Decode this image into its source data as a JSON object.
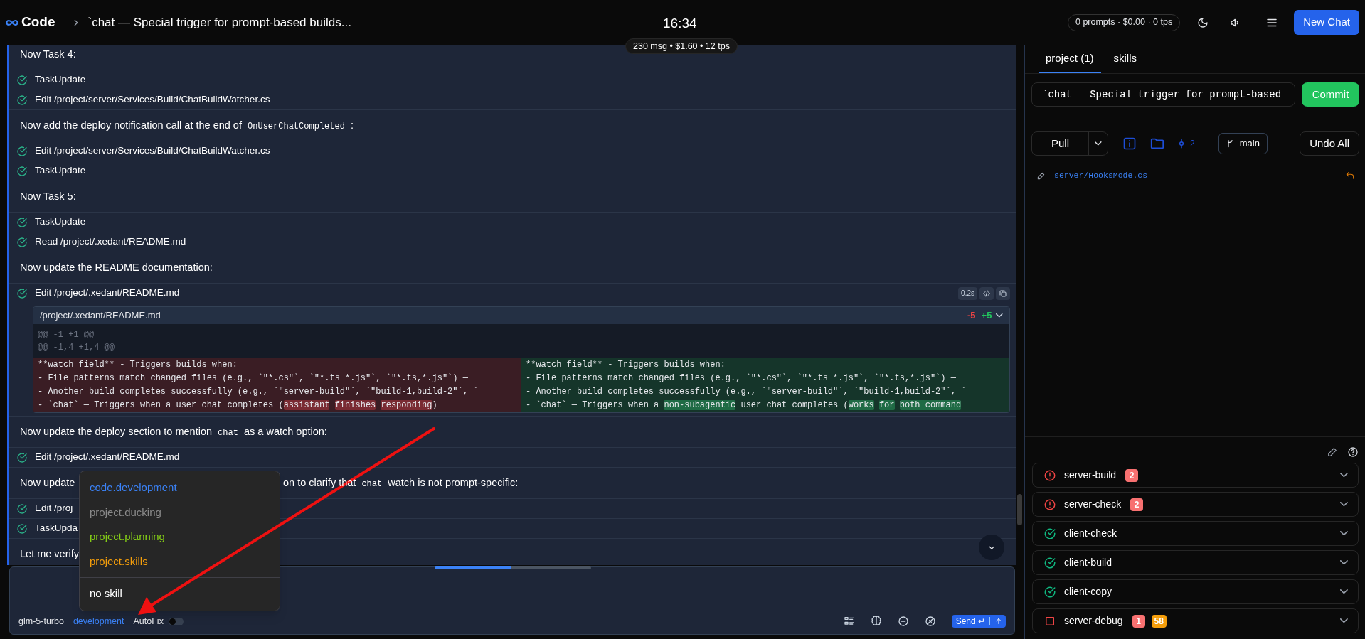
{
  "header": {
    "app_name": "Code",
    "title": "`chat — Special trigger for prompt-based builds...",
    "time": "16:34",
    "stats": "0 prompts · $0.00 · 0 tps",
    "new_chat": "New Chat"
  },
  "session_stats": "230 msg • $1.60 • 12 tps",
  "chat": {
    "messages": [
      {
        "kind": "text",
        "parts": [
          {
            "text": "Now Task 4:",
            "code": false
          }
        ]
      },
      {
        "kind": "tool",
        "label": "TaskUpdate"
      },
      {
        "kind": "tool",
        "label": "Edit /project/server/Services/Build/ChatBuildWatcher.cs"
      },
      {
        "kind": "text",
        "parts": [
          {
            "text": "Now add the deploy notification call at the end of",
            "code": false
          },
          {
            "text": "OnUserChatCompleted",
            "code": true
          },
          {
            "text": ":",
            "code": false
          }
        ]
      },
      {
        "kind": "tool",
        "label": "Edit /project/server/Services/Build/ChatBuildWatcher.cs"
      },
      {
        "kind": "tool",
        "label": "TaskUpdate"
      },
      {
        "kind": "text",
        "parts": [
          {
            "text": "Now Task 5:",
            "code": false
          }
        ]
      },
      {
        "kind": "tool",
        "label": "TaskUpdate"
      },
      {
        "kind": "tool",
        "label": "Read /project/.xedant/README.md"
      },
      {
        "kind": "text",
        "parts": [
          {
            "text": "Now update the README documentation:",
            "code": false
          }
        ]
      },
      {
        "kind": "tool",
        "label": "Edit /project/.xedant/README.md",
        "duration": "0.2s",
        "diff": {
          "file": "/project/.xedant/README.md",
          "removed": "-5",
          "added": "+5",
          "hunks": [
            "@@ -1 +1 @@",
            "@@ -1,4 +1,4 @@"
          ],
          "left": [
            [
              {
                "text": "**watch field** - Triggers builds when:",
                "changed": false
              }
            ],
            [
              {
                "text": "- File patterns match changed files (e.g., `\"*.cs\"`, `\"*.ts *.js\"`, `\"*.ts,*.js\"`) — ",
                "changed": false
              }
            ],
            [
              {
                "text": "- Another build completes successfully (e.g., `\"server-build\"`, `\"build-1,build-2\"`, `",
                "changed": false
              }
            ],
            [
              {
                "text": "- `chat` — Triggers when a user chat completes (",
                "changed": false
              },
              {
                "text": "assistant",
                "changed": true
              },
              {
                "text": " finishes",
                "changed": true
              },
              {
                "text": " responding",
                "changed": true
              },
              {
                "text": ")",
                "changed": false
              }
            ]
          ],
          "right": [
            [
              {
                "text": "**watch field** - Triggers builds when:",
                "changed": false
              }
            ],
            [
              {
                "text": "- File patterns match changed files (e.g., `\"*.cs\"`, `\"*.ts *.js\"`, `\"*.ts,*.js\"`) — ",
                "changed": false
              }
            ],
            [
              {
                "text": "- Another build completes successfully (e.g., `\"server-build\"`, `\"build-1,build-2\"`, `",
                "changed": false
              }
            ],
            [
              {
                "text": "- `chat` — Triggers when a ",
                "changed": false
              },
              {
                "text": "non-subagentic",
                "changed": true
              },
              {
                "text": " user chat completes (",
                "changed": false
              },
              {
                "text": "works",
                "changed": true
              },
              {
                "text": " for",
                "changed": true
              },
              {
                "text": " both command",
                "changed": true
              }
            ]
          ]
        }
      },
      {
        "kind": "text",
        "parts": [
          {
            "text": "Now update the deploy section to mention",
            "code": false
          },
          {
            "text": "chat",
            "code": true
          },
          {
            "text": "as a watch option:",
            "code": false
          }
        ]
      },
      {
        "kind": "tool",
        "label": "Edit /project/.xedant/README.md"
      },
      {
        "kind": "text",
        "parts": [
          {
            "text": "Now update",
            "code": false
          }
        ],
        "tail": [
          {
            "text": "on to clarify that",
            "code": false
          },
          {
            "text": "chat",
            "code": true
          },
          {
            "text": "watch is not prompt-specific:",
            "code": false
          }
        ]
      },
      {
        "kind": "tool",
        "label": "Edit /proj"
      },
      {
        "kind": "tool",
        "label": "TaskUpda"
      },
      {
        "kind": "text",
        "parts": [
          {
            "text": "Let me verify",
            "code": false
          }
        ]
      }
    ]
  },
  "skill_menu": {
    "items": [
      {
        "label": "code.development",
        "color": "#3b82f6"
      },
      {
        "label": "project.ducking",
        "color": "#8a8a8a"
      },
      {
        "label": "project.planning",
        "color": "#84cc16"
      },
      {
        "label": "project.skills",
        "color": "#f59e0b"
      }
    ],
    "footer": "no skill"
  },
  "composer": {
    "model": "glm-5-turbo",
    "skill": "development",
    "autofix": {
      "label": "AutoFix",
      "on": false
    },
    "send": "Send ↵"
  },
  "git_panel": {
    "tabs": [
      {
        "label": "project (1)",
        "selected": true
      },
      {
        "label": "skills",
        "selected": false
      }
    ],
    "commit_message": "`chat — Special trigger for prompt-based",
    "commit_button": "Commit",
    "pull": "Pull",
    "commit_count": "2",
    "branch": "main",
    "undo_all": "Undo All",
    "changed_files": [
      {
        "path": "server/HooksMode.cs"
      }
    ]
  },
  "builds": [
    {
      "name": "server-build",
      "kind": "error",
      "badges": [
        {
          "text": "2",
          "color": "#f87171"
        }
      ]
    },
    {
      "name": "server-check",
      "kind": "error",
      "badges": [
        {
          "text": "2",
          "color": "#f87171"
        }
      ]
    },
    {
      "name": "client-check",
      "kind": "success"
    },
    {
      "name": "client-build",
      "kind": "success"
    },
    {
      "name": "client-copy",
      "kind": "success"
    },
    {
      "name": "server-debug",
      "kind": "stopped",
      "badges": [
        {
          "text": "1",
          "color": "#f87171"
        },
        {
          "text": "58",
          "color": "#f59e0b"
        }
      ]
    }
  ]
}
